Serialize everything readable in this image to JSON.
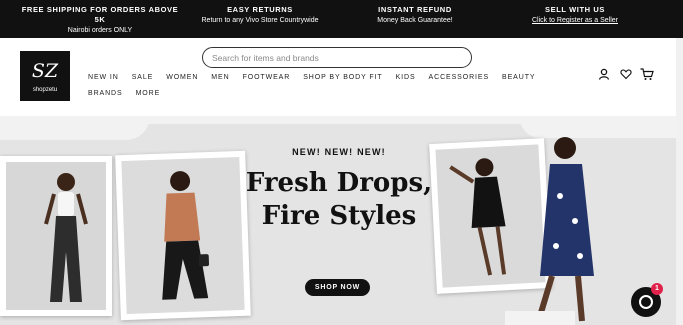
{
  "promo_bar": [
    {
      "title": "FREE SHIPPING FOR ORDERS ABOVE 5K",
      "subtitle": "Nairobi orders ONLY"
    },
    {
      "title": "EASY RETURNS",
      "subtitle": "Return to any Vivo Store Countrywide"
    },
    {
      "title": "INSTANT REFUND",
      "subtitle": "Money Back Guarantee!"
    },
    {
      "title": "SELL WITH US",
      "subtitle": "Click to Register as a Seller"
    }
  ],
  "header": {
    "logo_mark": "SZ",
    "logo_text": "shopzetu",
    "search_placeholder": "Search for items and brands",
    "nav": [
      "NEW IN",
      "SALE",
      "WOMEN",
      "MEN",
      "FOOTWEAR",
      "SHOP BY BODY FIT",
      "KIDS",
      "ACCESSORIES",
      "BEAUTY",
      "BRANDS",
      "MORE"
    ],
    "icons": [
      "account-icon",
      "wishlist-heart-icon",
      "cart-icon"
    ]
  },
  "hero": {
    "tagline": "NEW! NEW! NEW!",
    "headline_line1": "Fresh Drops,",
    "headline_line2": "Fire Styles",
    "cta": "SHOP NOW"
  },
  "chat": {
    "badge_count": "1"
  },
  "colors": {
    "bar": "#111111",
    "hero_bg": "#e4e4e4",
    "badge": "#e0224a"
  }
}
